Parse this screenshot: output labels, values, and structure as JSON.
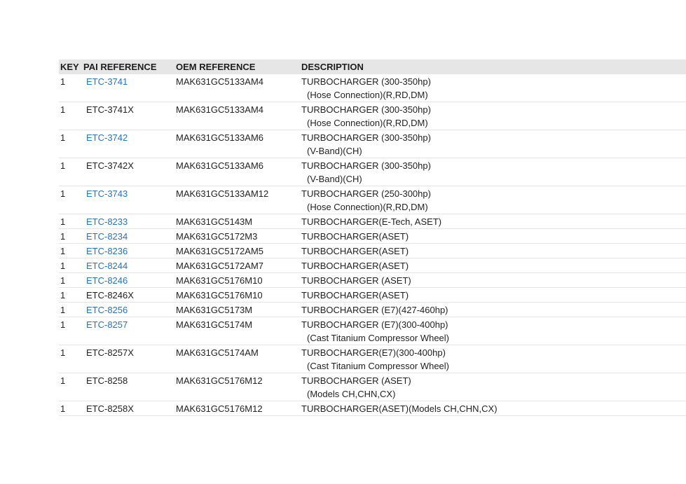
{
  "headers": {
    "key": "KEY",
    "pai": "PAI REFERENCE",
    "oem": "OEM REFERENCE",
    "desc": "DESCRIPTION"
  },
  "colors": {
    "link": "#2a73b5",
    "header_bg": "#e6e6e6",
    "text": "#222222",
    "divider": "#e4e4e4"
  },
  "rows": [
    {
      "key": "1",
      "pai": "ETC-3741",
      "linked": true,
      "oem": "MAK631GC5133AM4",
      "desc1": "TURBOCHARGER (300-350hp)",
      "desc2": "(Hose Connection)(R,RD,DM)"
    },
    {
      "key": "1",
      "pai": "ETC-3741X",
      "linked": false,
      "oem": "MAK631GC5133AM4",
      "desc1": "TURBOCHARGER (300-350hp)",
      "desc2": "(Hose Connection)(R,RD,DM)"
    },
    {
      "key": "1",
      "pai": "ETC-3742",
      "linked": true,
      "oem": "MAK631GC5133AM6",
      "desc1": "TURBOCHARGER (300-350hp)",
      "desc2": "(V-Band)(CH)"
    },
    {
      "key": "1",
      "pai": "ETC-3742X",
      "linked": false,
      "oem": "MAK631GC5133AM6",
      "desc1": "TURBOCHARGER (300-350hp)",
      "desc2": "(V-Band)(CH)"
    },
    {
      "key": "1",
      "pai": "ETC-3743",
      "linked": true,
      "oem": "MAK631GC5133AM12",
      "desc1": "TURBOCHARGER (250-300hp)",
      "desc2": "(Hose Connection)(R,RD,DM)"
    },
    {
      "key": "1",
      "pai": "ETC-8233",
      "linked": true,
      "oem": "MAK631GC5143M",
      "desc1": "TURBOCHARGER(E-Tech, ASET)",
      "desc2": ""
    },
    {
      "key": "1",
      "pai": "ETC-8234",
      "linked": true,
      "oem": "MAK631GC5172M3",
      "desc1": "TURBOCHARGER(ASET)",
      "desc2": ""
    },
    {
      "key": "1",
      "pai": "ETC-8236",
      "linked": true,
      "oem": "MAK631GC5172AM5",
      "desc1": "TURBOCHARGER(ASET)",
      "desc2": ""
    },
    {
      "key": "1",
      "pai": "ETC-8244",
      "linked": true,
      "oem": "MAK631GC5172AM7",
      "desc1": "TURBOCHARGER(ASET)",
      "desc2": ""
    },
    {
      "key": "1",
      "pai": "ETC-8246",
      "linked": true,
      "oem": "MAK631GC5176M10",
      "desc1": "TURBOCHARGER (ASET)",
      "desc2": ""
    },
    {
      "key": "1",
      "pai": "ETC-8246X",
      "linked": false,
      "oem": "MAK631GC5176M10",
      "desc1": "TURBOCHARGER(ASET)",
      "desc2": ""
    },
    {
      "key": "1",
      "pai": "ETC-8256",
      "linked": true,
      "oem": "MAK631GC5173M",
      "desc1": "TURBOCHARGER (E7)(427-460hp)",
      "desc2": ""
    },
    {
      "key": "1",
      "pai": "ETC-8257",
      "linked": true,
      "oem": "MAK631GC5174M",
      "desc1": "TURBOCHARGER (E7)(300-400hp)",
      "desc2": "(Cast Titanium Compressor Wheel)"
    },
    {
      "key": "1",
      "pai": "ETC-8257X",
      "linked": false,
      "oem": "MAK631GC5174AM",
      "desc1": "TURBOCHARGER(E7)(300-400hp)",
      "desc2": "(Cast Titanium Compressor Wheel)"
    },
    {
      "key": "1",
      "pai": "ETC-8258",
      "linked": false,
      "oem": "MAK631GC5176M12",
      "desc1": "TURBOCHARGER (ASET)",
      "desc2": "(Models CH,CHN,CX)"
    },
    {
      "key": "1",
      "pai": "ETC-8258X",
      "linked": false,
      "oem": "MAK631GC5176M12",
      "desc1": "TURBOCHARGER(ASET)(Models CH,CHN,CX)",
      "desc2": ""
    }
  ]
}
